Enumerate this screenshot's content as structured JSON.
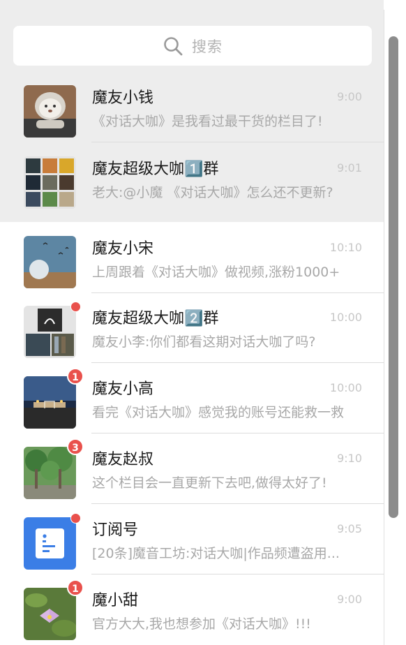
{
  "search": {
    "placeholder": "搜索"
  },
  "chats": [
    {
      "name": "魔友小钱",
      "time": "9:00",
      "preview": "《对话大咖》是我看过最干货的栏目了!",
      "pinned": true,
      "badge": null,
      "avatar": "cat-photo"
    },
    {
      "name": "魔友超级大咖1️⃣群",
      "time": "9:01",
      "preview": "老大:@小魔 《对话大咖》怎么还不更新?",
      "pinned": true,
      "badge": null,
      "avatar": "group-grid-1"
    },
    {
      "name": "魔友小宋",
      "time": "10:10",
      "preview": "上周跟着《对话大咖》做视频,涨粉1000+",
      "pinned": false,
      "badge": null,
      "avatar": "moon-photo"
    },
    {
      "name": "魔友超级大咖2️⃣群",
      "time": "10:00",
      "preview": "魔友小李:你们都看这期对话大咖了吗?",
      "pinned": false,
      "badge": "dot",
      "avatar": "group-grid-2"
    },
    {
      "name": "魔友小高",
      "time": "10:00",
      "preview": "看完《对话大咖》感觉我的账号还能救一救",
      "pinned": false,
      "badge": "1",
      "avatar": "night-photo"
    },
    {
      "name": "魔友赵叔",
      "time": "9:10",
      "preview": "这个栏目会一直更新下去吧,做得太好了!",
      "pinned": false,
      "badge": "3",
      "avatar": "trees-photo"
    },
    {
      "name": "订阅号",
      "time": "9:05",
      "preview": "[20条]魔音工坊:对话大咖|作品频遭盗用...",
      "pinned": false,
      "badge": "dot",
      "avatar": "subscription-icon"
    },
    {
      "name": "魔小甜",
      "time": "9:00",
      "preview": "官方大大,我也想参加《对话大咖》!!!",
      "pinned": false,
      "badge": "1",
      "avatar": "lotus-photo"
    }
  ],
  "colors": {
    "pinned_bg": "#ededed",
    "badge_red": "#e9514c",
    "subscription_blue": "#3b7ee6"
  }
}
